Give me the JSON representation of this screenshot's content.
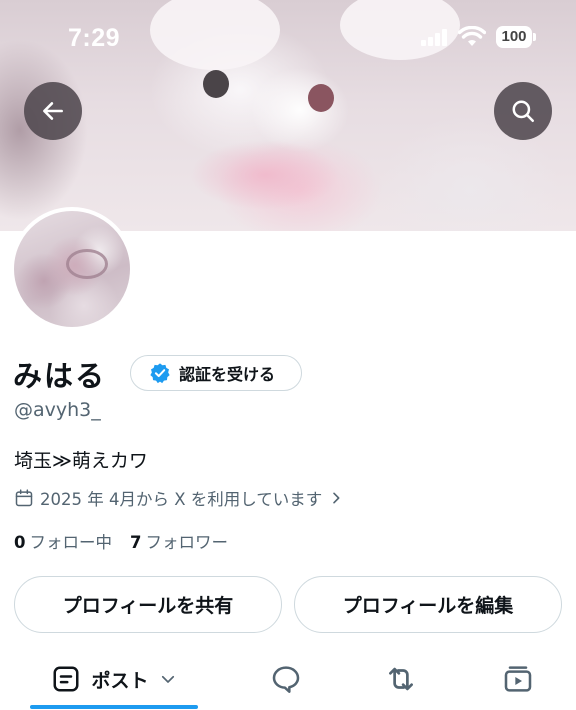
{
  "status_bar": {
    "time": "7:29",
    "battery": "100"
  },
  "header": {
    "back_icon": "arrow-left-icon",
    "search_icon": "search-icon"
  },
  "profile": {
    "display_name": "みはる",
    "verify_label": "認証を受ける",
    "verify_badge_color": "#1d9bf0",
    "handle": "@avyh3_",
    "bio": "埼玉≫萌えカワ",
    "joined": "2025 年 4月から X を利用しています",
    "following_count": "0",
    "following_label": "フォロー中",
    "followers_count": "7",
    "followers_label": "フォロワー"
  },
  "actions": {
    "share_label": "プロフィールを共有",
    "edit_label": "プロフィールを編集"
  },
  "tabs": {
    "posts_label": "ポスト",
    "items": [
      {
        "icon": "posts-icon",
        "selected": true
      },
      {
        "icon": "reply-bubble-icon"
      },
      {
        "icon": "repost-icon"
      },
      {
        "icon": "video-icon"
      }
    ]
  },
  "colors": {
    "accent": "#1d9bf0",
    "text_primary": "#0f1419",
    "text_secondary": "#536471",
    "border": "#cfd9de"
  }
}
